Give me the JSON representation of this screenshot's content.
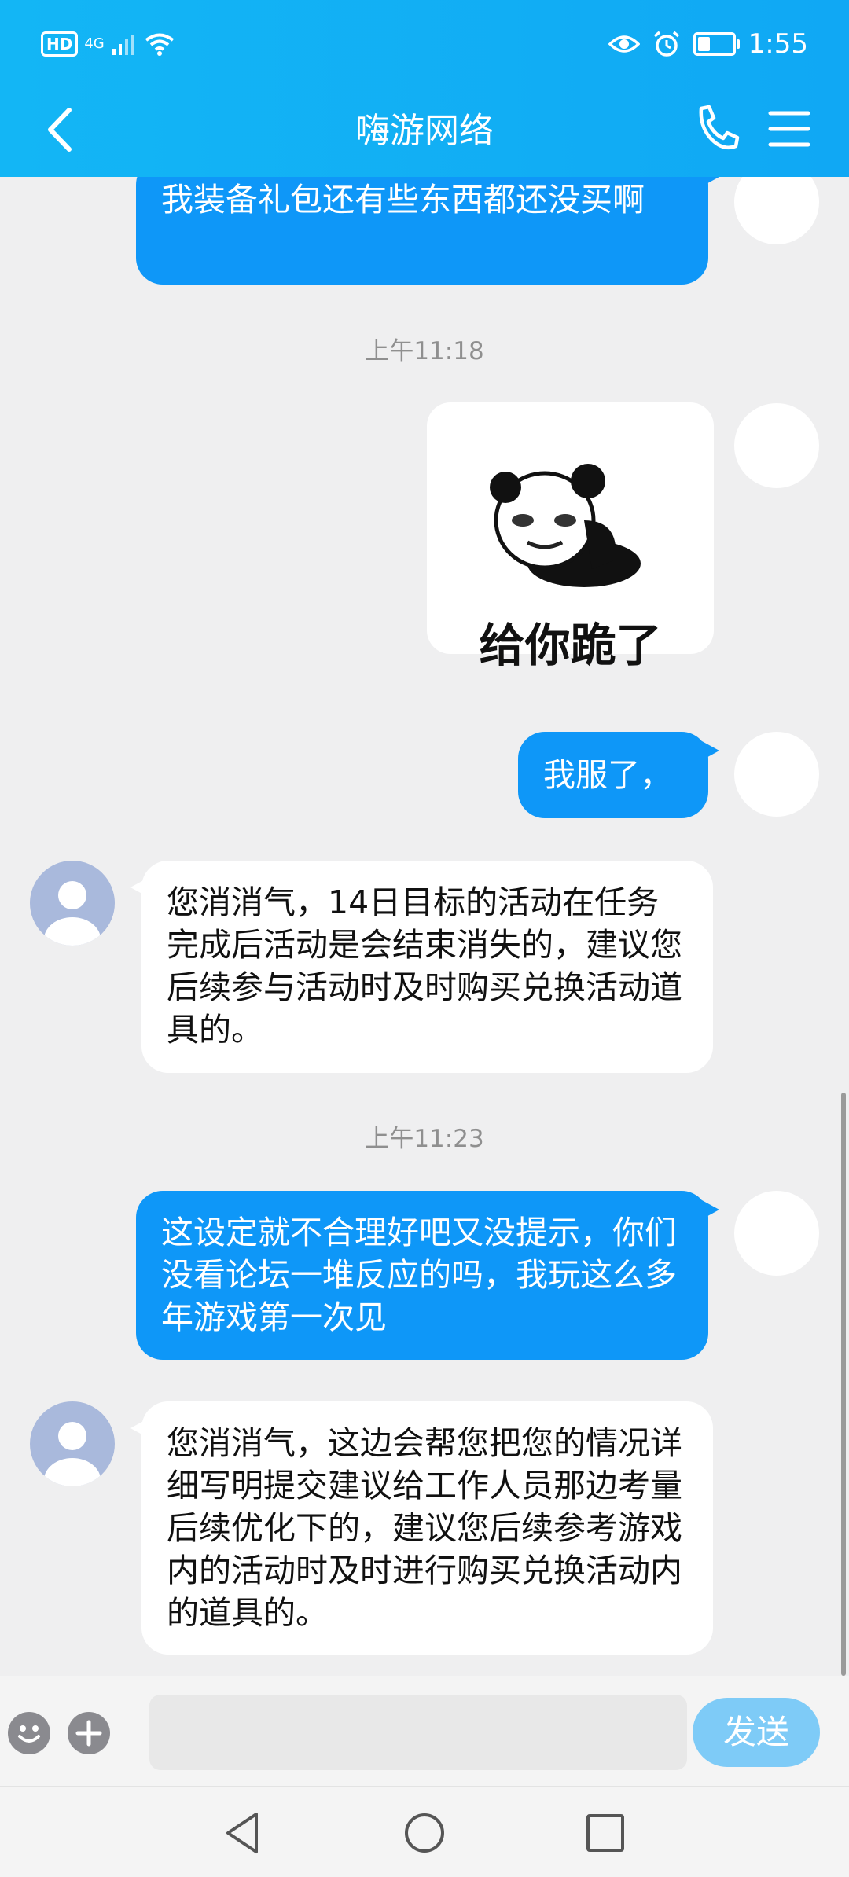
{
  "status_bar": {
    "hd": "HD",
    "network": "4G",
    "time": "1:55",
    "battery_level": 0.35
  },
  "header": {
    "title": "嗨游网络"
  },
  "messages": {
    "m1": "我装备礼包还有些东西都还没买啊",
    "t1": "上午11:18",
    "sticker_caption": "给你跪了",
    "m2": "我服了，",
    "m3": "您消消气，14日目标的活动在任务完成后活动是会结束消失的，建议您后续参与活动时及时购买兑换活动道具的。",
    "t2": "上午11:23",
    "m4": "这设定就不合理好吧又没提示，你们没看论坛一堆反应的吗，我玩这么多年游戏第一次见",
    "m5": "您消消气，这边会帮您把您的情况详细写明提交建议给工作人员那边考量后续优化下的，建议您后续参考游戏内的活动时及时进行购买兑换活动内的道具的。"
  },
  "input": {
    "value": "",
    "send_label": "发送"
  },
  "colors": {
    "header": "#13b6f5",
    "my_bubble": "#0e97f8",
    "send_button": "#7ecbf7",
    "background": "#efeff0"
  }
}
